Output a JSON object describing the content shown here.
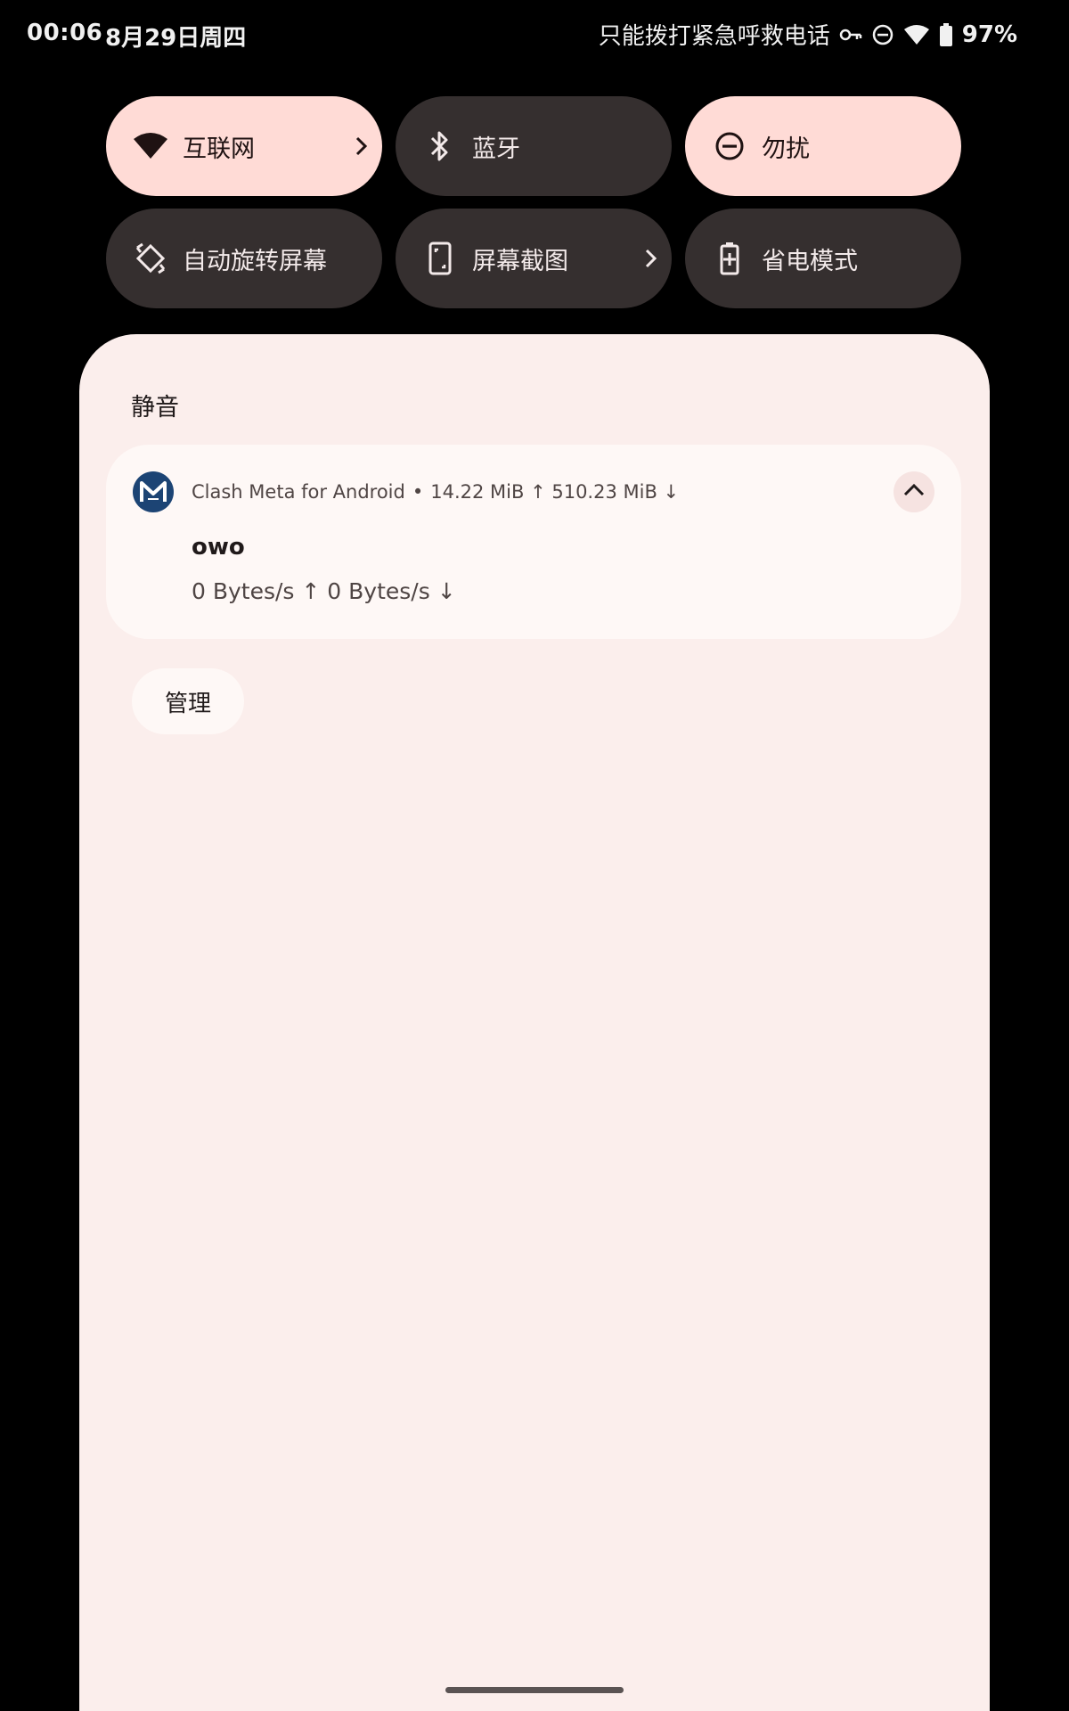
{
  "status_bar": {
    "time": "00:06",
    "date": "8月29日周四",
    "carrier_text": "只能拨打紧急呼救电话",
    "battery": "97%",
    "icons": [
      "vpn-key-icon",
      "dnd-icon",
      "wifi-icon",
      "battery-icon"
    ]
  },
  "quick_settings": {
    "tiles": [
      {
        "label": "互联网",
        "icon": "wifi-icon",
        "state": "on",
        "has_chevron": true
      },
      {
        "label": "蓝牙",
        "icon": "bluetooth-icon",
        "state": "off",
        "has_chevron": false
      },
      {
        "label": "勿扰",
        "icon": "dnd-icon",
        "state": "on",
        "has_chevron": false
      },
      {
        "label": "自动旋转屏幕",
        "icon": "auto-rotate-icon",
        "state": "off",
        "has_chevron": false
      },
      {
        "label": "屏幕截图",
        "icon": "screenshot-icon",
        "state": "off",
        "has_chevron": true
      },
      {
        "label": "省电模式",
        "icon": "battery-saver-icon",
        "state": "off",
        "has_chevron": false
      }
    ]
  },
  "shade": {
    "section_title": "静音",
    "notification": {
      "app_name": "Clash Meta for Android",
      "separator": "•",
      "traffic_summary": "14.22 MiB ↑ 510.23 MiB ↓",
      "title": "owo",
      "text": "0 Bytes/s ↑ 0 Bytes/s ↓"
    },
    "manage_label": "管理"
  },
  "colors": {
    "background": "#000000",
    "tile_on": "#ffdbd6",
    "tile_off": "#352f2f",
    "shade": "#fbeeec",
    "card": "#fef8f6",
    "app_icon": "#1c4474"
  }
}
